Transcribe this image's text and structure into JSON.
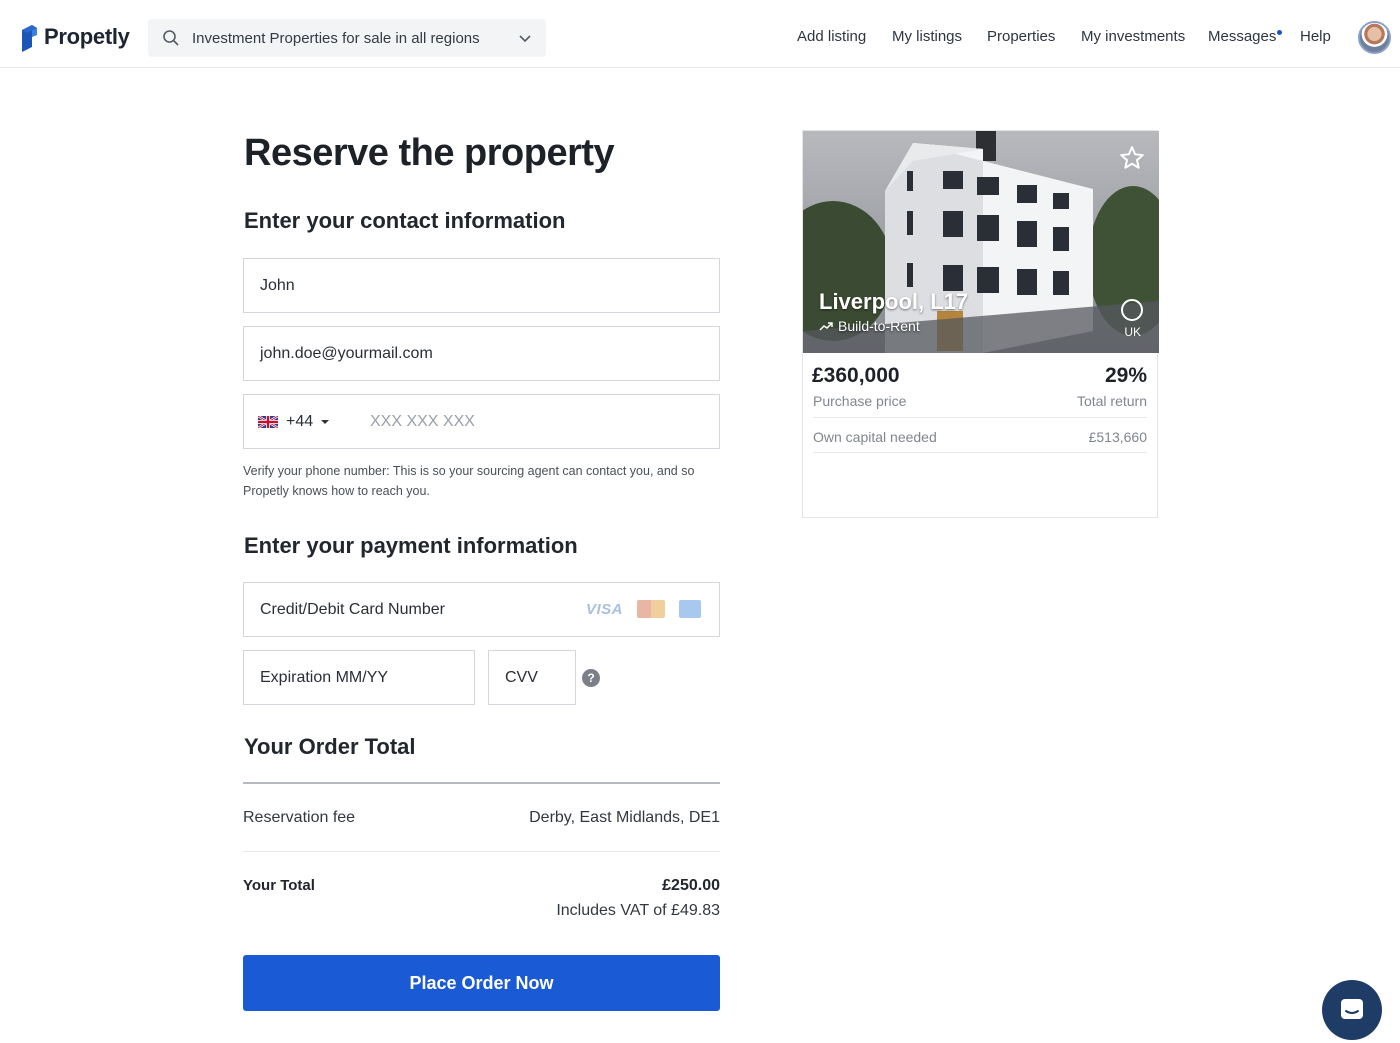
{
  "brand": {
    "name": "Propetly",
    "accent": "#1a5ad4"
  },
  "search": {
    "value": "Investment Properties for sale in all regions"
  },
  "nav": {
    "add_listing": "Add listing",
    "my_listings": "My listings",
    "properties": "Properties",
    "my_investments": "My investments",
    "messages": "Messages",
    "help": "Help"
  },
  "form": {
    "title": "Reserve the property",
    "contact_heading": "Enter your contact information",
    "name_value": "John",
    "email_value": "john.doe@yourmail.com",
    "phone_code": "+44",
    "phone_placeholder": "XXX XXX XXX",
    "phone_help": "Verify your phone number: This is so your sourcing agent can contact you, and so Propetly knows how to reach you.",
    "payment_heading": "Enter your payment information",
    "card_placeholder": "Credit/Debit Card Number",
    "card_brand_visa": "VISA",
    "expiry_placeholder": "Expiration MM/YY",
    "cvv_placeholder": "CVV",
    "cvv_help": "?"
  },
  "order": {
    "heading": "Your Order Total",
    "fee_label": "Reservation fee",
    "fee_value": "Derby, East Midlands, DE1",
    "total_label": "Your Total",
    "total_value": "£250.00",
    "vat_note": "Includes VAT of £49.83",
    "button_label": "Place Order Now"
  },
  "property": {
    "city": "Liverpool, L17",
    "strategy": "Build-to-Rent",
    "country": "UK",
    "price": "£360,000",
    "price_label": "Purchase price",
    "return": "29%",
    "return_label": "Total return",
    "capital_label": "Own capital needed",
    "capital_value": "£513,660"
  }
}
